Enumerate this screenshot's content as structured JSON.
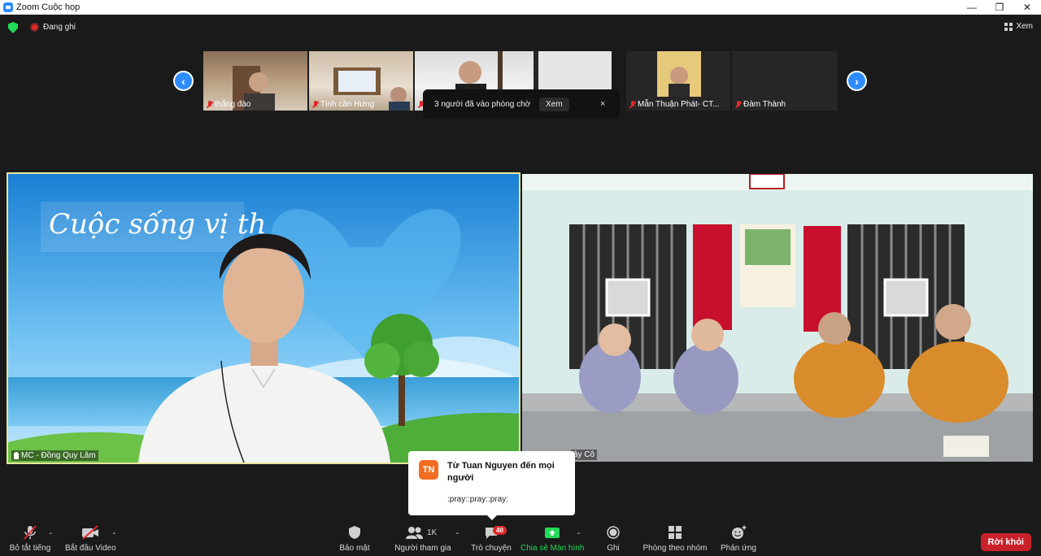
{
  "window": {
    "title": "Zoom Cuộc họp",
    "minimize": "—",
    "restore": "❐",
    "close": "✕"
  },
  "topbar": {
    "recording_label": "Đang ghi",
    "view_label": "Xem"
  },
  "thumbnails": [
    {
      "name": "thắng đào"
    },
    {
      "name": "Tịnh cần Hưng"
    },
    {
      "name": ""
    },
    {
      "name": "Mẫn Thuận Phát- CT..."
    },
    {
      "name": "Đàm Thành"
    }
  ],
  "waiting_toast": {
    "text": "3 người đã vào phòng chờ",
    "button": "Xem",
    "close": "×"
  },
  "videos": {
    "main_left": {
      "name": "MC - Đồng Quy Lâm",
      "overlay_text": "Cuộc sống vị th"
    },
    "main_right": {
      "name": "ây Cô"
    }
  },
  "chat_popup": {
    "avatar_initials": "TN",
    "from": "Từ Tuan Nguyen đến mọi người",
    "message": ":pray::pray::pray:"
  },
  "toolbar": {
    "mute": "Bỏ tắt tiếng",
    "video": "Bắt đầu Video",
    "security": "Bảo mật",
    "participants": "Người tham gia",
    "participants_count": "1K",
    "chat": "Trò chuyện",
    "chat_badge": "40",
    "share": "Chia sẻ Màn hình",
    "record": "Ghi",
    "breakout": "Phòng theo nhóm",
    "reactions": "Phản ứng",
    "leave": "Rời khỏi"
  },
  "colors": {
    "accent": "#2d8cff",
    "share_green": "#23d959",
    "leave_red": "#c9212a",
    "active_border": "#e6e69a"
  }
}
